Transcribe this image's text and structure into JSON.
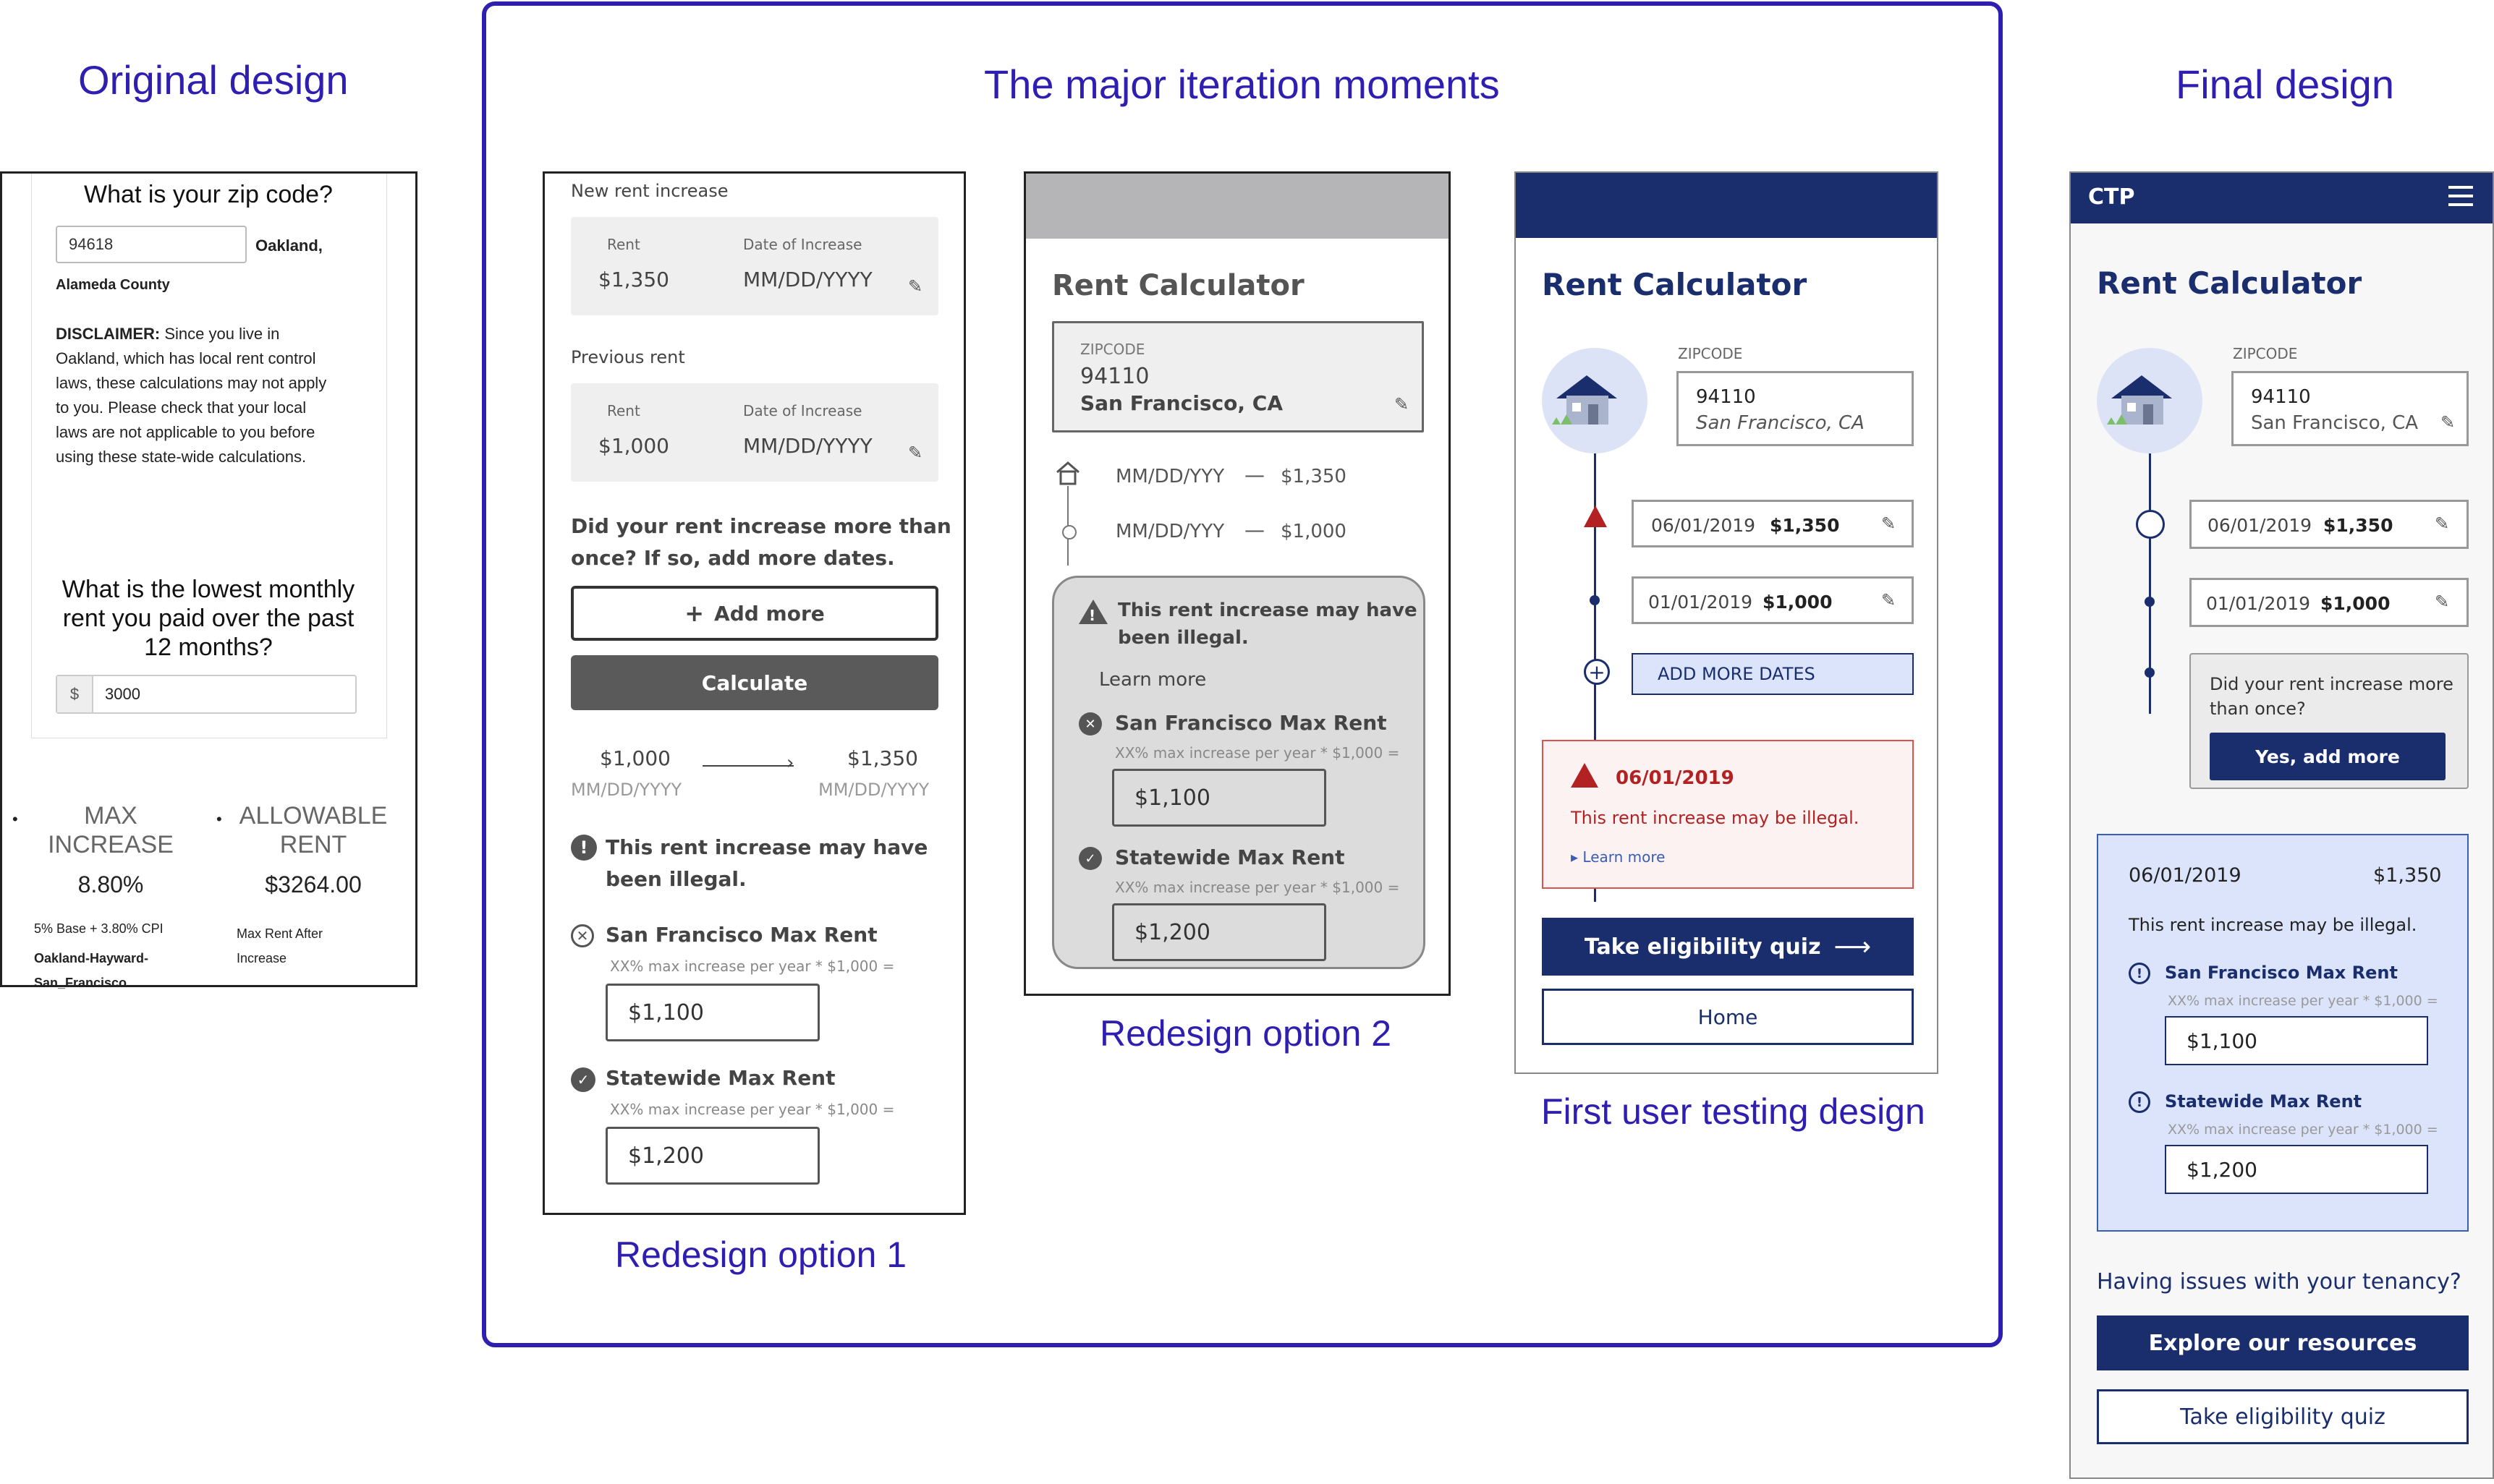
{
  "section_titles": {
    "original": "Original design",
    "iterations": "The major iteration moments",
    "final": "Final design"
  },
  "captions": {
    "option1": "Redesign option 1",
    "option2": "Redesign option 2",
    "user_testing": "First user testing design"
  },
  "original": {
    "zip_question": "What is your zip code?",
    "zip_value": "94618",
    "city": "Oakland,",
    "county": "Alameda County",
    "disclaimer_label": "DISCLAIMER:",
    "disclaimer_lines": [
      "Since you live in",
      "Oakland, which has local rent control",
      "laws, these calculations may not apply",
      "to you. Please check that your local",
      "laws are not applicable to you before",
      "using these state-wide calculations."
    ],
    "rent_question_lines": [
      "What is the lowest monthly",
      "rent you paid over the past",
      "12 months?"
    ],
    "currency_symbol": "$",
    "rent_value": "3000",
    "max_increase_lines": [
      "MAX",
      "INCREASE"
    ],
    "max_increase_value": "8.80%",
    "allowable_rent_lines": [
      "ALLOWABLE",
      "RENT"
    ],
    "allowable_rent_value": "$3264.00",
    "cpi_note": "5% Base + 3.80% CPI",
    "region_lines": [
      "Oakland-Hayward-",
      "San_Francisco"
    ],
    "max_rent_note_lines": [
      "Max Rent After",
      "Increase"
    ]
  },
  "option1": {
    "new_rent_title": "New rent increase",
    "rent_label": "Rent",
    "date_label": "Date of Increase",
    "new_rent_value": "$1,350",
    "date_placeholder": "MM/DD/YYYY",
    "prev_rent_title": "Previous rent",
    "prev_rent_value": "$1,000",
    "question_lines": [
      "Did your rent increase more than",
      "once? If so, add more dates."
    ],
    "add_more": "Add more",
    "calculate": "Calculate",
    "from_value": "$1,000",
    "to_value": "$1,350",
    "illegal_lines": [
      "This rent increase may have",
      "been illegal."
    ],
    "sf_max": "San Francisco Max Rent",
    "formula": "XX% max increase per year * $1,000 =",
    "sf_value": "$1,100",
    "state_max": "Statewide Max Rent",
    "state_value": "$1,200"
  },
  "option2": {
    "title": "Rent Calculator",
    "zip_label": "ZIPCODE",
    "zip_value": "94110",
    "city": "San Francisco, CA",
    "date_placeholder": "MM/DD/YYY",
    "dash": "—",
    "rent_new": "$1,350",
    "rent_old": "$1,000",
    "illegal_lines": [
      "This rent increase may have",
      "been illegal."
    ],
    "learn_more": "Learn more",
    "sf_max": "San Francisco Max Rent",
    "formula": "XX% max increase per year * $1,000 =",
    "sf_value": "$1,100",
    "state_max": "Statewide Max Rent",
    "state_value": "$1,200"
  },
  "user_testing": {
    "title": "Rent Calculator",
    "zip_label": "ZIPCODE",
    "zip_value": "94110",
    "city": "San Francisco, CA",
    "date1": "06/01/2019",
    "rent1": "$1,350",
    "date2": "01/01/2019",
    "rent2": "$1,000",
    "add_more_dates": "ADD MORE DATES",
    "alert_date": "06/01/2019",
    "alert_text": "This rent increase may be illegal.",
    "learn_more": "Learn more",
    "quiz_button": "Take eligibility quiz",
    "home_button": "Home"
  },
  "final": {
    "brand": "CTP",
    "title": "Rent Calculator",
    "zip_label": "ZIPCODE",
    "zip_value": "94110",
    "city": "San Francisco, CA",
    "date1": "06/01/2019",
    "rent1": "$1,350",
    "date2": "01/01/2019",
    "rent2": "$1,000",
    "question_lines": [
      "Did your rent increase more",
      "than once?"
    ],
    "add_more_button": "Yes, add more",
    "result_date": "06/01/2019",
    "result_rent": "$1,350",
    "result_text": "This rent increase may be illegal.",
    "sf_max": "San Francisco Max Rent",
    "formula": "XX% max increase per year * $1,000 =",
    "sf_value": "$1,100",
    "state_max": "Statewide Max Rent",
    "state_value": "$1,200",
    "issues_text": "Having issues with your tenancy?",
    "explore_button": "Explore our resources",
    "quiz_button": "Take eligibility quiz"
  }
}
